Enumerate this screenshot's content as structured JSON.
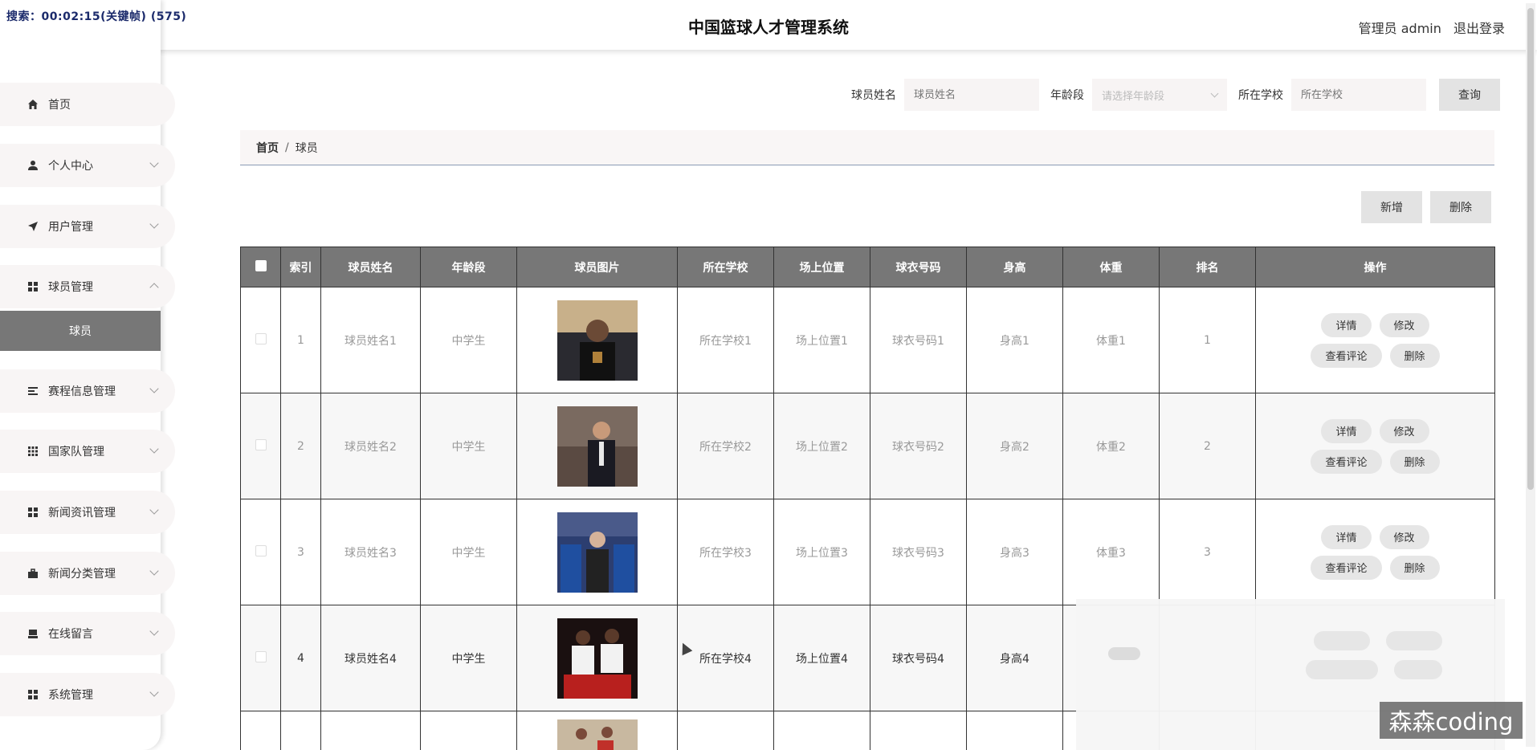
{
  "recorder": "搜索：00:02:15(关键帧) (575)",
  "header": {
    "title": "中国篮球人才管理系统",
    "user": "管理员 admin",
    "logout": "退出登录"
  },
  "sidebar": {
    "items": [
      {
        "label": "首页",
        "icon": "home-icon"
      },
      {
        "label": "个人中心",
        "icon": "user-icon"
      },
      {
        "label": "用户管理",
        "icon": "send-icon"
      },
      {
        "label": "球员管理",
        "icon": "grid-icon"
      },
      {
        "label": "赛程信息管理",
        "icon": "list-icon"
      },
      {
        "label": "国家队管理",
        "icon": "grid9-icon"
      },
      {
        "label": "新闻资讯管理",
        "icon": "grid-icon"
      },
      {
        "label": "新闻分类管理",
        "icon": "briefcase-icon"
      },
      {
        "label": "在线留言",
        "icon": "printer-icon"
      },
      {
        "label": "系统管理",
        "icon": "grid-icon"
      }
    ],
    "sub_item": "球员"
  },
  "search": {
    "name_label": "球员姓名",
    "name_placeholder": "球员姓名",
    "age_label": "年龄段",
    "age_placeholder": "请选择年龄段",
    "school_label": "所在学校",
    "school_placeholder": "所在学校",
    "query": "查询"
  },
  "breadcrumb": {
    "home": "首页",
    "sep": "/",
    "current": "球员"
  },
  "actions": {
    "add": "新增",
    "delete": "删除"
  },
  "table": {
    "headers": [
      "索引",
      "球员姓名",
      "年龄段",
      "球员图片",
      "所在学校",
      "场上位置",
      "球衣号码",
      "身高",
      "体重",
      "排名",
      "操作"
    ],
    "rows": [
      {
        "idx": "1",
        "name": "球员姓名1",
        "age": "中学生",
        "school": "所在学校1",
        "pos": "场上位置1",
        "num": "球衣号码1",
        "height": "身高1",
        "weight": "体重1",
        "rank": "1"
      },
      {
        "idx": "2",
        "name": "球员姓名2",
        "age": "中学生",
        "school": "所在学校2",
        "pos": "场上位置2",
        "num": "球衣号码2",
        "height": "身高2",
        "weight": "体重2",
        "rank": "2"
      },
      {
        "idx": "3",
        "name": "球员姓名3",
        "age": "中学生",
        "school": "所在学校3",
        "pos": "场上位置3",
        "num": "球衣号码3",
        "height": "身高3",
        "weight": "体重3",
        "rank": "3"
      },
      {
        "idx": "4",
        "name": "球员姓名4",
        "age": "中学生",
        "school": "所在学校4",
        "pos": "场上位置4",
        "num": "球衣号码4",
        "height": "身高4",
        "weight": "",
        "rank": ""
      }
    ],
    "ops": {
      "detail": "详情",
      "edit": "修改",
      "comments": "查看评论",
      "delete": "删除"
    }
  },
  "watermark": "森森coding"
}
